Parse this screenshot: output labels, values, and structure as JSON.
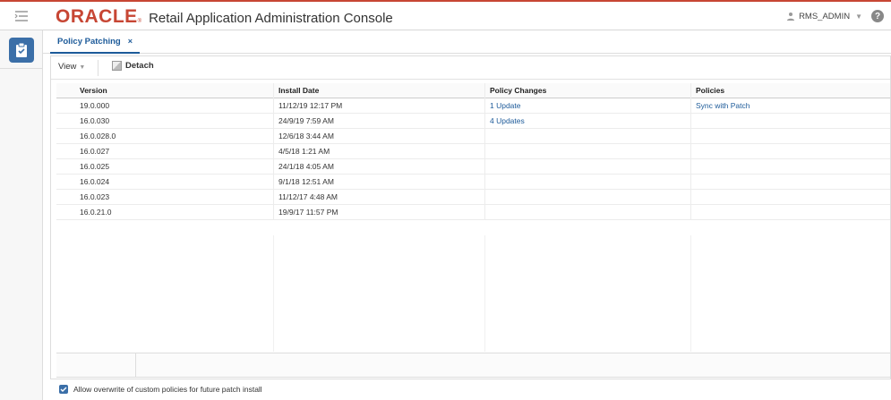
{
  "header": {
    "logo": "ORACLE",
    "title": "Retail Application Administration Console",
    "user": "RMS_ADMIN",
    "help": "?"
  },
  "tab": {
    "label": "Policy Patching",
    "close": "×"
  },
  "toolbar": {
    "view_label": "View",
    "detach_label": "Detach"
  },
  "table": {
    "columns": [
      "Version",
      "Install Date",
      "Policy Changes",
      "Policies"
    ],
    "rows": [
      [
        "19.0.000",
        "11/12/19 12:17 PM",
        "1 Update",
        "Sync with Patch"
      ],
      [
        "16.0.030",
        "24/9/19 7:59 AM",
        "4 Updates",
        ""
      ],
      [
        "16.0.028.0",
        "12/6/18 3:44 AM",
        "",
        ""
      ],
      [
        "16.0.027",
        "4/5/18 1:21 AM",
        "",
        ""
      ],
      [
        "16.0.025",
        "24/1/18 4:05 AM",
        "",
        ""
      ],
      [
        "16.0.024",
        "9/1/18 12:51 AM",
        "",
        ""
      ],
      [
        "16.0.023",
        "11/12/17 4:48 AM",
        "",
        ""
      ],
      [
        "16.0.21.0",
        "19/9/17 11:57 PM",
        "",
        ""
      ]
    ]
  },
  "checkbox": {
    "label": "Allow overwrite of custom policies for future patch install",
    "checked": true
  },
  "colors": {
    "oracle_red": "#c74634",
    "link_blue": "#1c5a99",
    "rail_blue": "#3b6fa8"
  }
}
